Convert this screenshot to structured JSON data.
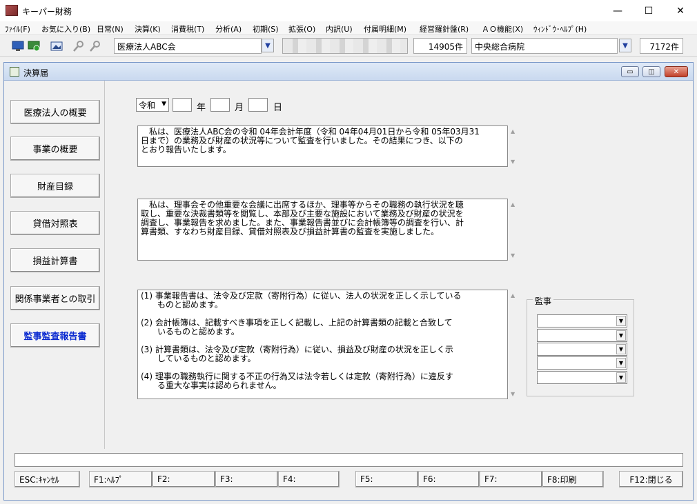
{
  "window": {
    "title": "キーパー財務",
    "minimize": "—",
    "maximize": "☐",
    "close": "✕"
  },
  "menu": [
    "ﾌｧｲﾙ(F)",
    "お気に入り(B)",
    "日常(N)",
    "決算(K)",
    "消費税(T)",
    "分析(A)",
    "初期(S)",
    "拡張(O)",
    "内訳(U)",
    "付属明細(M)",
    "経営羅針盤(R)",
    "ＡＯ機能(X)",
    "ｳｨﾝﾄﾞｳ･ﾍﾙﾌﾟ(H)"
  ],
  "toolbar": {
    "corp_select": "医療法人ABC会",
    "corp_count": "14905件",
    "facility_select": "中央総合病院",
    "facility_count": "7172件"
  },
  "child": {
    "title": "決算届",
    "min": "▭",
    "restore": "◫",
    "close": "✕"
  },
  "nav": [
    "医療法人の概要",
    "事業の概要",
    "財産目録",
    "貸借対照表",
    "損益計算書",
    "関係事業者との取引",
    "監事監査報告書"
  ],
  "date": {
    "era": "令和",
    "era_arrow": "▼",
    "year_unit": "年",
    "month_unit": "月",
    "day_unit": "日"
  },
  "text1": [
    "　私は、医療法人ABC会の令和 04年会計年度（令和 04年04月01日から令和 05年03月31",
    "日まで）の業務及び財産の状況等について監査を行いました。その結果につき、以下の",
    "とおり報告いたします。"
  ],
  "text2": [
    "　私は、理事会その他重要な会議に出席するほか、理事等からその職務の執行状況を聴",
    "取し、重要な決裁書類等を閲覧し、本部及び主要な施設において業務及び財産の状況を",
    "調査し、事業報告を求めました。また、事業報告書並びに会計帳簿等の調査を行い、計",
    "算書類、すなわち財産目録、貸借対照表及び損益計算書の監査を実施しました。"
  ],
  "text3": [
    "(1) 事業報告書は、法令及び定款（寄附行為）に従い、法人の状況を正しく示している",
    "　　ものと認めます。",
    "",
    "(2) 会計帳簿は、記載すべき事項を正しく記載し、上記の計算書類の記載と合致して",
    "　　いるものと認めます。",
    "",
    "(3) 計算書類は、法令及び定款（寄附行為）に従い、損益及び財産の状況を正しく示",
    "　　しているものと認めます。",
    "",
    "(4) 理事の職務執行に関する不正の行為又は法令若しくは定款（寄附行為）に違反す",
    "　　る重大な事実は認められません。"
  ],
  "kanji_label": "監事",
  "scroll_up": "▲",
  "scroll_down": "▼",
  "combo_arrow": "▼",
  "fkeys": [
    "ESC:ｷｬﾝｾﾙ",
    "F1:ﾍﾙﾌﾟ",
    "F2:",
    "F3:",
    "F4:",
    "F5:",
    "F6:",
    "F7:",
    "F8:印刷",
    "F12:閉じる"
  ]
}
